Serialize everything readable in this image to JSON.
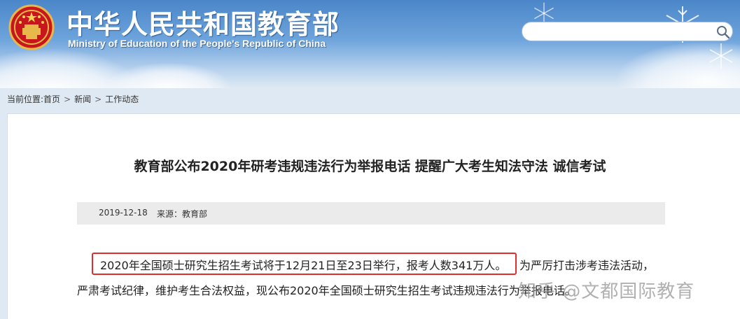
{
  "header": {
    "site_title": "中华人民共和国教育部",
    "site_subtitle": "Ministry of Education of the People's Republic of China",
    "search": {
      "placeholder": ""
    }
  },
  "breadcrumb": {
    "prefix": "当前位置:",
    "items": [
      "首页",
      "新闻",
      "工作动态"
    ],
    "separator": ">"
  },
  "article": {
    "title": "教育部公布2020年研考违规违法行为举报电话 提醒广大考生知法守法 诚信考试",
    "date": "2019-12-18",
    "source": "来源：教育部",
    "para_line1_highlighted": "2020年全国硕士研究生招生考试将于12月21日至23日举行，报考人数341万人。",
    "para_line1_rest": "为严厉打击涉考违法活动，",
    "para_line2": "严肃考试纪律，维护考生合法权益，现公布2020年全国硕士研究生招生考试违规违法行为举报电话。"
  },
  "watermark": "知乎 @文都国际教育",
  "colors": {
    "header_blue": "#4b86c9",
    "highlight_red": "#e02d2d",
    "meta_bar_gray": "#ebebeb"
  }
}
